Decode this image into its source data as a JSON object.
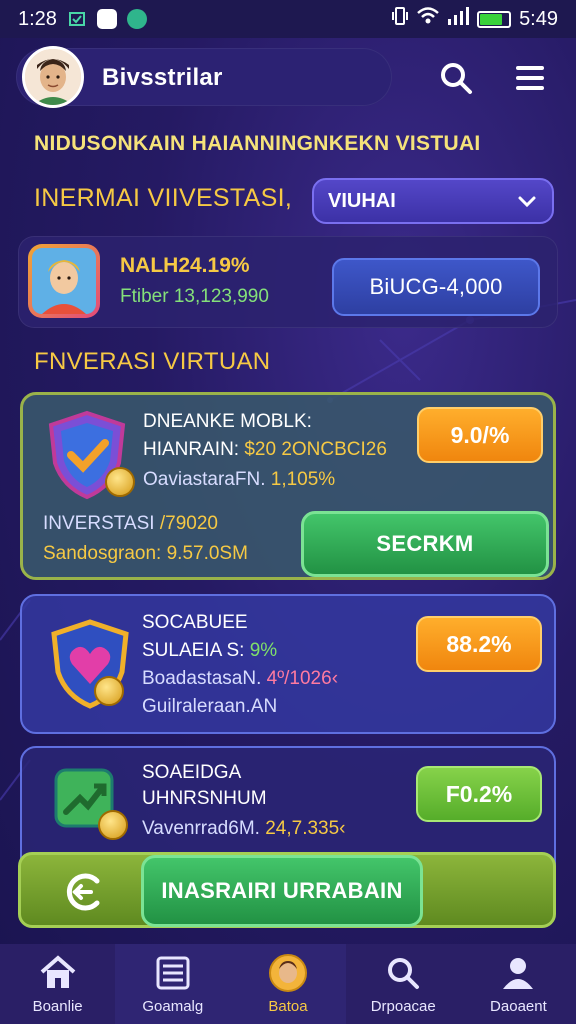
{
  "status": {
    "time": "1:28",
    "clock_right": "5:49"
  },
  "header": {
    "app_title": "Bivsstrilar"
  },
  "banner": "NIDUSONKAIN HAIANNINGNKEKN VISTUAI",
  "section_title": "INERMAI VIIVESTASI,",
  "dropdown": {
    "selected": "VIUHAI"
  },
  "summary": {
    "rate": "NALH24.19%",
    "sub": "Ftiber 13,123,990",
    "button": "BiUCG-4,000"
  },
  "section2": "FNVERASI VIRTUAN",
  "cards": [
    {
      "title": "DNEANKE MOBLK:",
      "line2_label": "HIANRAIN: ",
      "line2_value": "$20",
      "line2_extra": " 2ONCBCI26",
      "line3_label": "OaviastaraFN.",
      "line3_value": " 1,105%",
      "line4_label": "INVERSTASI ",
      "line4_value": "/79020",
      "line5": "Sandosgraon: 9.57.0SM",
      "badge": "9.0/%",
      "button": "SECRKM"
    },
    {
      "title": "SOCABUEE",
      "line2_label": "SULAEIA S: ",
      "line2_value": "9%",
      "line3_label": "BoadastasaN.",
      "line3_value": " 4º/1026‹",
      "line4": "Guilraleraan.AN",
      "badge": "88.2%"
    },
    {
      "title": "SOAEIDGA",
      "line2": "UHNRSNHUM",
      "line3_label": "Vavenrrad6M.",
      "line3_value": " 24,7.335‹",
      "badge": "F0.2%"
    }
  ],
  "action_button": "INASRAIRI URRABAIN",
  "tabs": [
    {
      "label": "Boanlie",
      "icon": "home-icon"
    },
    {
      "label": "Goamalg",
      "icon": "list-icon"
    },
    {
      "label": "Batoa",
      "icon": "avatar-icon"
    },
    {
      "label": "Drpoacae",
      "icon": "search-icon"
    },
    {
      "label": "Daoaent",
      "icon": "person-icon"
    }
  ],
  "colors": {
    "accent_yellow": "#f6c944",
    "green": "#7fe06a",
    "orange": "#f0860e",
    "background": "#251a63"
  }
}
